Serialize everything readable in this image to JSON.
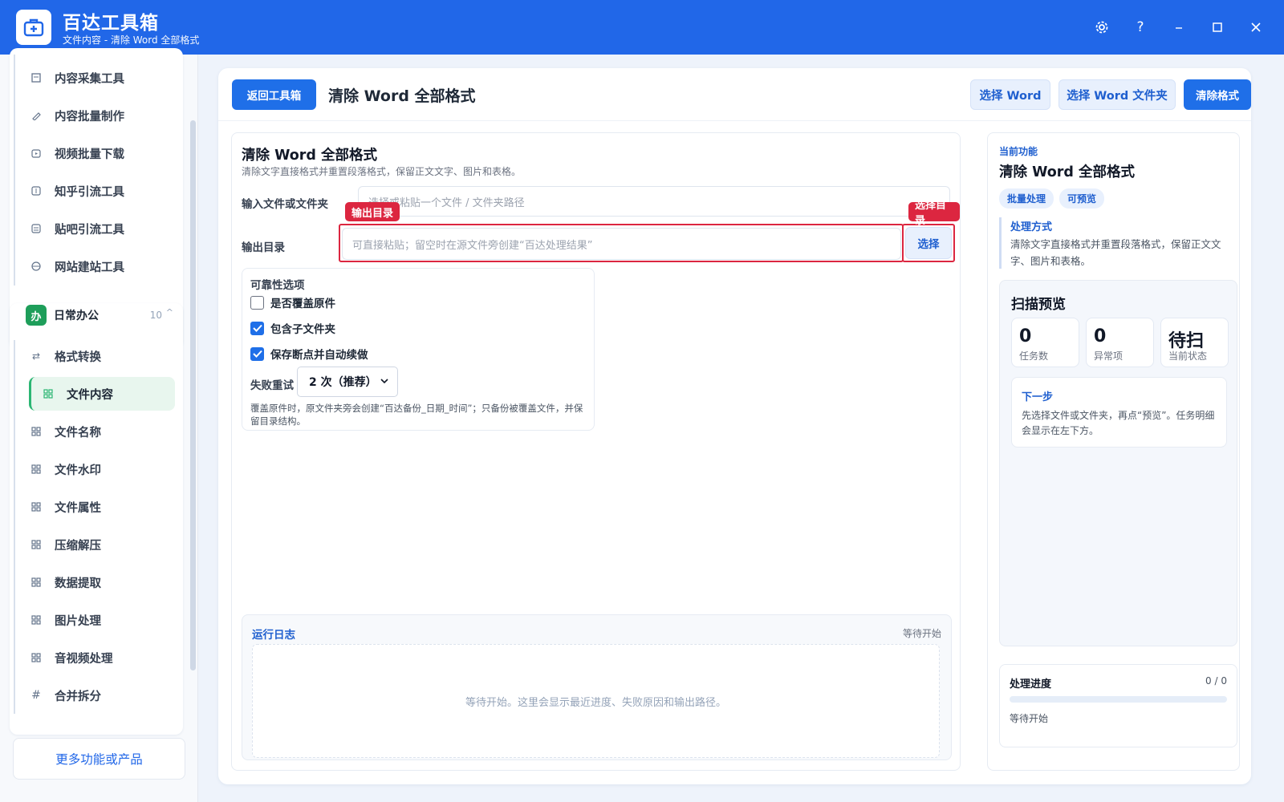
{
  "window": {
    "title": "百达工具箱",
    "subtitle": "文件内容 - 清除 Word 全部格式"
  },
  "sidebar": {
    "top_items": [
      {
        "label": "内容采集工具",
        "icon": "document-icon"
      },
      {
        "label": "内容批量制作",
        "icon": "pen-icon"
      },
      {
        "label": "视频批量下载",
        "icon": "video-icon"
      },
      {
        "label": "知乎引流工具",
        "icon": "zhihu-icon"
      },
      {
        "label": "贴吧引流工具",
        "icon": "list-icon"
      },
      {
        "label": "网站建站工具",
        "icon": "globe-icon"
      }
    ],
    "group": {
      "badge": "办",
      "name": "日常办公",
      "count": "10"
    },
    "group_items": [
      {
        "label": "格式转换",
        "icon": "swap-icon"
      },
      {
        "label": "文件内容",
        "icon": "grid-icon"
      },
      {
        "label": "文件名称",
        "icon": "grid-icon"
      },
      {
        "label": "文件水印",
        "icon": "grid-icon"
      },
      {
        "label": "文件属性",
        "icon": "grid-icon"
      },
      {
        "label": "压缩解压",
        "icon": "grid-icon"
      },
      {
        "label": "数据提取",
        "icon": "grid-icon"
      },
      {
        "label": "图片处理",
        "icon": "grid-icon"
      },
      {
        "label": "音视频处理",
        "icon": "grid-icon"
      },
      {
        "label": "合并拆分",
        "icon": "hash-icon"
      }
    ],
    "active_item": "文件内容",
    "more_button": "更多功能或产品"
  },
  "toolbar": {
    "back_label": "返回工具箱",
    "page_title": "清除 Word 全部格式",
    "select_word": "选择 Word",
    "select_folder": "选择 Word 文件夹",
    "run": "清除格式"
  },
  "form": {
    "title": "清除 Word 全部格式",
    "desc": "清除文字直接格式并重置段落格式，保留正文文字、图片和表格。",
    "input_label": "输入文件或文件夹",
    "input_placeholder": "选择或粘贴一个文件 / 文件夹路径",
    "output_label": "输出目录",
    "output_placeholder": "可直接粘贴；留空时在源文件旁创建“百达处理结果”",
    "choose_label": "选择",
    "tag_output": "输出目录",
    "tag_choose": "选择目录"
  },
  "options": {
    "title": "可靠性选项",
    "items": [
      {
        "label": "是否覆盖原件",
        "checked": false
      },
      {
        "label": "包含子文件夹",
        "checked": true
      },
      {
        "label": "保存断点并自动续做",
        "checked": true
      }
    ],
    "retry_label": "失败重试",
    "retry_value": "2 次（推荐）",
    "note": "覆盖原件时，原文件夹旁会创建“百达备份_日期_时间”；只备份被覆盖文件，并保留目录结构。"
  },
  "log": {
    "title": "运行日志",
    "status": "等待开始",
    "empty": "等待开始。这里会显示最近进度、失败原因和输出路径。"
  },
  "info_panel": {
    "section_label": "当前功能",
    "title": "清除 Word 全部格式",
    "tags": [
      "批量处理",
      "可预览"
    ],
    "method_label": "处理方式",
    "method_text": "清除文字直接格式并重置段落格式，保留正文文字、图片和表格。"
  },
  "scan": {
    "title": "扫描预览",
    "stats": [
      {
        "value": "0",
        "label": "任务数"
      },
      {
        "value": "0",
        "label": "异常项"
      },
      {
        "value": "待扫",
        "label": "当前状态"
      }
    ],
    "next_title": "下一步",
    "next_text": "先选择文件或文件夹，再点“预览”。任务明细会显示在左下方。"
  },
  "progress": {
    "title": "处理进度",
    "count": "0 / 0",
    "fraction": 0,
    "status": "等待开始"
  },
  "colors": {
    "titlebar": "#2167e8",
    "primary": "#1f6fe8",
    "highlight": "#dc2640",
    "group_green": "#1e9e5a"
  }
}
